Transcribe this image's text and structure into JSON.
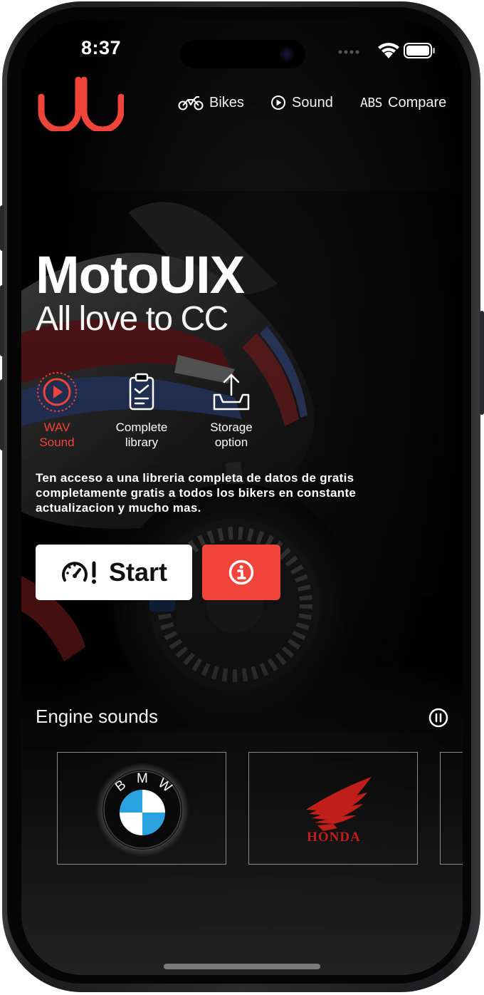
{
  "status_bar": {
    "time": "8:37"
  },
  "nav": {
    "bikes_label": "Bikes",
    "sound_label": "Sound",
    "compare_label": "Compare",
    "compare_prefix": "ABS"
  },
  "hero": {
    "title": "MotoUIX",
    "subtitle": "All love to CC"
  },
  "features": [
    {
      "line1": "WAV",
      "line2": "Sound",
      "icon": "play-circle-icon",
      "active": true
    },
    {
      "line1": "Complete",
      "line2": "library",
      "icon": "clipboard-check-icon",
      "active": false
    },
    {
      "line1": "Storage",
      "line2": "option",
      "icon": "tray-upload-icon",
      "active": false
    }
  ],
  "description": "Ten acceso a una libreria completa de datos de  gratis completamente gratis a todos los bikers en constante actualizacion y mucho mas.",
  "actions": {
    "start_label": "Start",
    "start_icon": "speedometer-alert-icon",
    "info_icon": "info-circle-icon"
  },
  "engine_sounds": {
    "title": "Engine sounds",
    "cards": [
      {
        "brand": "BMW",
        "logo_text": "BMW"
      },
      {
        "brand": "Honda",
        "logo_text": "HONDA"
      },
      {
        "brand": "partial"
      }
    ]
  },
  "colors": {
    "accent": "#f0443a",
    "background": "#000000",
    "text": "#ffffff",
    "bmw_blue": "#2aa3e0",
    "honda_red": "#d0261c"
  }
}
